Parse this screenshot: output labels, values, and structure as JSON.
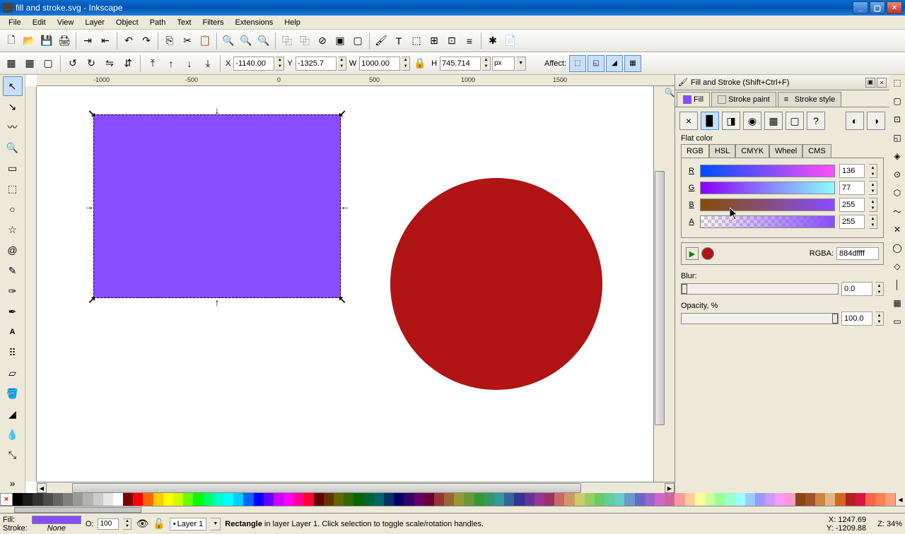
{
  "title": "fill and stroke.svg - Inkscape",
  "menu": [
    "File",
    "Edit",
    "View",
    "Layer",
    "Object",
    "Path",
    "Text",
    "Filters",
    "Extensions",
    "Help"
  ],
  "coords": {
    "x": "-1140.00",
    "y": "-1325.7",
    "w": "1000.00",
    "h": "745.714",
    "unit": "px",
    "affect": "Affect:"
  },
  "panel": {
    "title": "Fill and Stroke (Shift+Ctrl+F)",
    "tabs": [
      "Fill",
      "Stroke paint",
      "Stroke style"
    ],
    "flat_label": "Flat color",
    "color_tabs": [
      "RGB",
      "HSL",
      "CMYK",
      "Wheel",
      "CMS"
    ],
    "channels": [
      {
        "l": "R",
        "v": "136"
      },
      {
        "l": "G",
        "v": "77"
      },
      {
        "l": "B",
        "v": "255"
      },
      {
        "l": "A",
        "v": "255"
      }
    ],
    "rgba_label": "RGBA:",
    "rgba_value": "884dffff",
    "blur_label": "Blur:",
    "blur_value": "0.0",
    "opacity_label": "Opacity, %",
    "opacity_value": "100.0"
  },
  "status": {
    "fill_label": "Fill:",
    "stroke_label": "Stroke:",
    "stroke_value": "None",
    "o_label": "O:",
    "o_value": "100",
    "layer": "Layer 1",
    "obj": "Rectangle",
    "hint": " in layer Layer 1. Click selection to toggle scale/rotation handles.",
    "x": "X: 1247.69",
    "y": "Y: -1209.88",
    "z": "Z: 34%"
  },
  "ruler_labels": [
    "-1000",
    "-500",
    "0",
    "500",
    "1000",
    "1500"
  ],
  "palette_colors": [
    "#000000",
    "#1a1a1a",
    "#333333",
    "#4d4d4d",
    "#666666",
    "#808080",
    "#999999",
    "#b3b3b3",
    "#cccccc",
    "#e6e6e6",
    "#ffffff",
    "#800000",
    "#ff0000",
    "#ff6600",
    "#ffcc00",
    "#ffff00",
    "#ccff00",
    "#66ff00",
    "#00ff00",
    "#00ff66",
    "#00ffcc",
    "#00ffff",
    "#00ccff",
    "#0066ff",
    "#0000ff",
    "#6600ff",
    "#cc00ff",
    "#ff00ff",
    "#ff0099",
    "#ff0033",
    "#660000",
    "#663300",
    "#666600",
    "#336600",
    "#006600",
    "#006633",
    "#006666",
    "#003366",
    "#000066",
    "#330066",
    "#660066",
    "#660033",
    "#993333",
    "#996633",
    "#999933",
    "#669933",
    "#339933",
    "#339966",
    "#339999",
    "#336699",
    "#333399",
    "#663399",
    "#993399",
    "#993366",
    "#cc6666",
    "#cc9966",
    "#cccc66",
    "#99cc66",
    "#66cc66",
    "#66cc99",
    "#66cccc",
    "#6699cc",
    "#6666cc",
    "#9966cc",
    "#cc66cc",
    "#cc6699",
    "#ff9999",
    "#ffcc99",
    "#ffff99",
    "#ccff99",
    "#99ff99",
    "#99ffcc",
    "#99ffff",
    "#99ccff",
    "#9999ff",
    "#cc99ff",
    "#ff99ff",
    "#ff99cc",
    "#8b4513",
    "#a0522d",
    "#cd853f",
    "#deb887",
    "#d2691e",
    "#b22222",
    "#dc143c",
    "#ff6347",
    "#ff7f50",
    "#ffa07a"
  ]
}
